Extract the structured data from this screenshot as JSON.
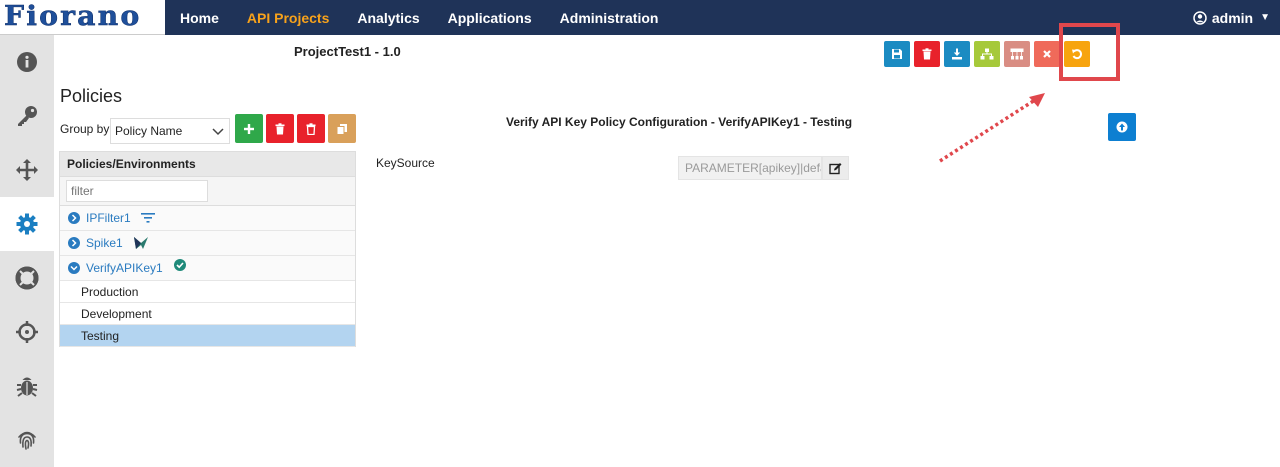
{
  "brand": {
    "logo_text": "Fiorano"
  },
  "nav": {
    "items": [
      {
        "label": "Home",
        "active": false
      },
      {
        "label": "API Projects",
        "active": true
      },
      {
        "label": "Analytics",
        "active": false
      },
      {
        "label": "Applications",
        "active": false
      },
      {
        "label": "Administration",
        "active": false
      }
    ],
    "user": "admin"
  },
  "sidebar": {
    "icons": [
      "info-icon",
      "key-icon",
      "move-icon",
      "gear-icon",
      "lifebuoy-icon",
      "crosshair-icon",
      "bug-icon",
      "fingerprint-icon"
    ],
    "active": "gear-icon"
  },
  "project": {
    "title": "ProjectTest1 - 1.0"
  },
  "toolbar": {
    "buttons": [
      {
        "icon": "save-icon",
        "color": "#1b8bc2"
      },
      {
        "icon": "trash-icon",
        "color": "#e8222b"
      },
      {
        "icon": "download-icon",
        "color": "#1b8bc2"
      },
      {
        "icon": "hierarchy-icon",
        "color": "#a6c93a"
      },
      {
        "icon": "network-icon",
        "color": "#d98d83"
      },
      {
        "icon": "close-icon",
        "color": "#ef6a5a"
      },
      {
        "icon": "undo-icon",
        "color": "#f7a40e"
      }
    ]
  },
  "policies": {
    "heading": "Policies",
    "group_by_label": "Group by",
    "group_by_value": "Policy Name",
    "tree_header": "Policies/Environments",
    "filter_placeholder": "filter",
    "items": [
      {
        "label": "IPFilter1",
        "icon": "filter-icon",
        "expanded": false
      },
      {
        "label": "Spike1",
        "icon": "spike-icon",
        "expanded": false
      },
      {
        "label": "VerifyAPIKey1",
        "icon": "check-badge-icon",
        "expanded": true
      }
    ],
    "environments": [
      "Production",
      "Development",
      "Testing"
    ],
    "selected_environment": "Testing"
  },
  "config": {
    "title": "Verify API Key Policy Configuration - VerifyAPIKey1 - Testing",
    "key_source_label": "KeySource",
    "key_source_value": "PARAMETER[apikey]|default"
  },
  "colors": {
    "nav_bg": "#1f3358",
    "accent": "#f7a21b",
    "link": "#2a7bc0",
    "highlight": "#e0474c"
  }
}
